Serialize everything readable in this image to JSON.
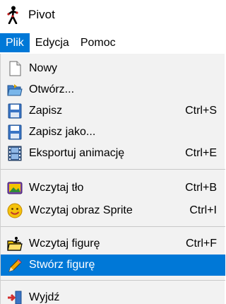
{
  "window": {
    "title": "Pivot",
    "icon": "stick-figure-icon"
  },
  "menubar": {
    "items": [
      {
        "label": "Plik",
        "active": true
      },
      {
        "label": "Edycja",
        "active": false
      },
      {
        "label": "Pomoc",
        "active": false
      }
    ]
  },
  "file_menu": {
    "items": [
      {
        "label": "Nowy",
        "shortcut": "",
        "icon": "new-document-icon"
      },
      {
        "label": "Otwórz...",
        "shortcut": "",
        "icon": "open-folder-icon"
      },
      {
        "label": "Zapisz",
        "shortcut": "Ctrl+S",
        "icon": "save-disk-icon"
      },
      {
        "label": "Zapisz jako...",
        "shortcut": "",
        "icon": "save-as-disk-icon"
      },
      {
        "label": "Eksportuj animację",
        "shortcut": "Ctrl+E",
        "icon": "film-strip-icon"
      },
      {
        "label": "Wczytaj tło",
        "shortcut": "Ctrl+B",
        "icon": "background-image-icon"
      },
      {
        "label": "Wczytaj obraz Sprite",
        "shortcut": "Ctrl+I",
        "icon": "smiley-icon"
      },
      {
        "label": "Wczytaj figurę",
        "shortcut": "Ctrl+F",
        "icon": "load-figure-icon"
      },
      {
        "label": "Stwórz figurę",
        "shortcut": "",
        "icon": "pencil-icon",
        "highlighted": true
      },
      {
        "label": "Wyjdź",
        "shortcut": "",
        "icon": "exit-door-icon"
      }
    ]
  },
  "colors": {
    "highlight": "#0078d7",
    "menu_bg": "#f2f2f2",
    "separator": "#c8c8c8"
  }
}
